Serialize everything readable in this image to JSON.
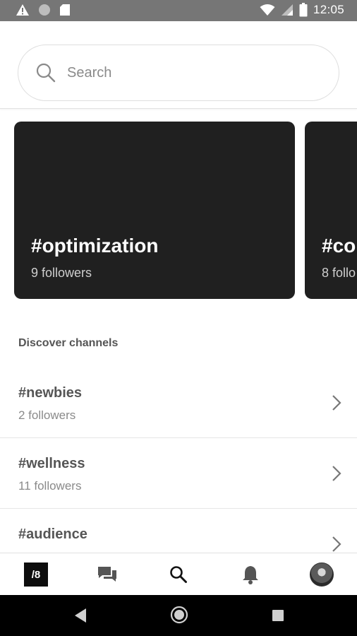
{
  "status_bar": {
    "time": "12:05",
    "icons": [
      "warning-icon",
      "circle-icon",
      "sd-card-icon",
      "wifi-icon",
      "signal-icon",
      "battery-icon"
    ]
  },
  "search": {
    "placeholder": "Search"
  },
  "featured_channels": [
    {
      "name": "#optimization",
      "followers": "9 followers"
    },
    {
      "name": "#co",
      "followers": "8 follo"
    }
  ],
  "discover": {
    "title": "Discover channels",
    "channels": [
      {
        "name": "#newbies",
        "followers": "2 followers"
      },
      {
        "name": "#wellness",
        "followers": "11 followers"
      },
      {
        "name": "#audience",
        "followers": ""
      }
    ]
  },
  "bottom_nav": {
    "logo_text": "/8",
    "items": [
      "home-logo",
      "chat-icon",
      "search-icon",
      "bell-icon",
      "avatar"
    ]
  },
  "colors": {
    "card_bg": "#202020",
    "status_bar": "#767676",
    "system_nav": "#000000"
  }
}
